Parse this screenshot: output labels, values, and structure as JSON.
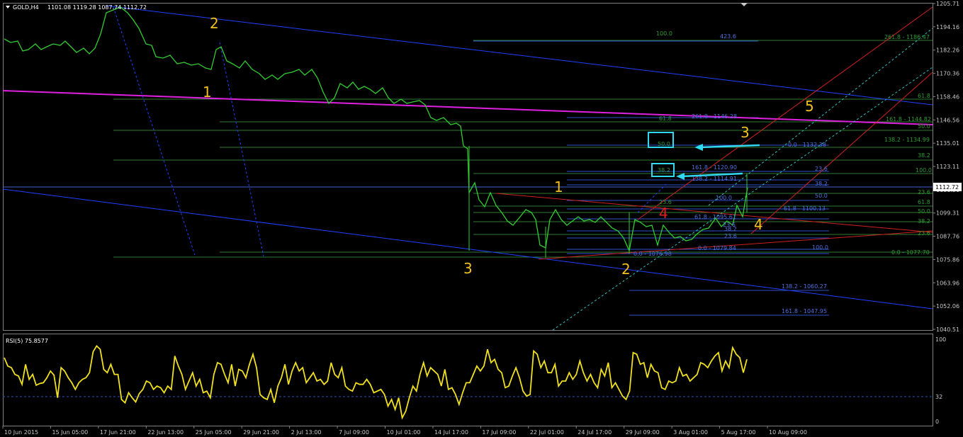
{
  "window": {
    "symbol_label": "GOLD,H4",
    "ohlc_label": "1101.08 1119.28 1087.74 1112.72",
    "current_price_label": "1112.72"
  },
  "price_axis": {
    "ticks": [
      "1205.71",
      "1194.16",
      "1182.26",
      "1170.36",
      "1158.46",
      "1146.56",
      "1135.01",
      "1123.11",
      "1111.21",
      "1099.31",
      "1087.76",
      "1075.86",
      "1063.96",
      "1052.06",
      "1040.51"
    ]
  },
  "time_axis": {
    "ticks": [
      "10 Jun 2015",
      "15 Jun 05:00",
      "17 Jun 21:00",
      "22 Jun 13:00",
      "25 Jun 05:00",
      "29 Jun 21:00",
      "2 Jul 13:00",
      "7 Jul 09:00",
      "10 Jul 01:00",
      "14 Jul 17:00",
      "17 Jul 09:00",
      "22 Jul 01:00",
      "24 Jul 17:00",
      "29 Jul 09:00",
      "3 Aug 01:00",
      "5 Aug 17:00",
      "10 Aug 09:00"
    ]
  },
  "waves": {
    "w2_top": "2",
    "w1_top": "1",
    "w3_bottom": "3",
    "w1_mid": "1",
    "w2_bottom": "2",
    "w4_red": "4",
    "w3_mid": "3",
    "w4_right": "4",
    "w5": "5"
  },
  "fib_labels": {
    "f1": "100.0",
    "f2": "423.6",
    "f3": "261.8 - 1186.47",
    "f4": "61.8",
    "f5": "61.8",
    "f6": "261.8 - 1146.28",
    "f7": "161.8 - 1144.82",
    "f8": "50.0",
    "f9": "138.2 - 1134.99",
    "f10": "50.0",
    "f11": "0.0 - 1132.38",
    "f12": "38.2",
    "f13": "161.8 - 1120.90",
    "f14": "23.6",
    "f15": "100.0",
    "f16": "38.2",
    "f17": "138.2 - 1114.91",
    "f18": "38.2",
    "f19": "23.6",
    "f20": "100.0",
    "f21": "50.0",
    "f22": "23.6",
    "f23": "61.8",
    "f24": "61.8 - 1100.13",
    "f25": "50.0",
    "f26": "61.8 - 1095.61",
    "f27": "38.2",
    "f28": "38.2",
    "f29": "23.6",
    "f30": "23.6",
    "f31": "0.0 - 1079.84",
    "f32": "100.0",
    "f33": "0.0 - 1076.98",
    "f34": "0.0 - 1077.70",
    "f35": "138.2 - 1060.27",
    "f36": "161.8 - 1047.95",
    "f37": "23.6"
  },
  "rsi": {
    "label": "RSI(5) 75.8577",
    "levels": [
      "100",
      "32",
      "0"
    ],
    "values": [
      78,
      68,
      66,
      58,
      56,
      46,
      70,
      52,
      58,
      45,
      47,
      48,
      54,
      62,
      57,
      30,
      66,
      62,
      54,
      48,
      40,
      48,
      52,
      54,
      60,
      85,
      92,
      88,
      64,
      60,
      70,
      58,
      58,
      28,
      24,
      36,
      30,
      25,
      35,
      40,
      50,
      48,
      40,
      44,
      42,
      36,
      44,
      40,
      80,
      68,
      58,
      40,
      50,
      60,
      44,
      52,
      36,
      38,
      30,
      58,
      72,
      70,
      58,
      48,
      70,
      44,
      64,
      62,
      54,
      70,
      82,
      66,
      34,
      30,
      28,
      40,
      24,
      44,
      54,
      70,
      46,
      62,
      72,
      62,
      66,
      48,
      54,
      60,
      50,
      52,
      46,
      50,
      72,
      58,
      54,
      66,
      44,
      40,
      38,
      48,
      46,
      46,
      52,
      46,
      36,
      38,
      40,
      34,
      20,
      28,
      16,
      30,
      6,
      14,
      30,
      44,
      38,
      58,
      72,
      56,
      66,
      62,
      58,
      44,
      64,
      40,
      42,
      34,
      22,
      36,
      48,
      48,
      58,
      68,
      62,
      68,
      88,
      72,
      76,
      64,
      60,
      42,
      44,
      56,
      66,
      54,
      38,
      32,
      34,
      86,
      82,
      66,
      74,
      60,
      60,
      70,
      44,
      50,
      50,
      60,
      52,
      58,
      74,
      60,
      50,
      58,
      48,
      42,
      64,
      56,
      72,
      42,
      48,
      40,
      32,
      28,
      38,
      84,
      82,
      70,
      72,
      54,
      70,
      62,
      60,
      42,
      40,
      50,
      48,
      50,
      66,
      56,
      58,
      50,
      54,
      58,
      72,
      70,
      66,
      74,
      80,
      84,
      62,
      74,
      66,
      90,
      82,
      78,
      60,
      76
    ]
  }
}
